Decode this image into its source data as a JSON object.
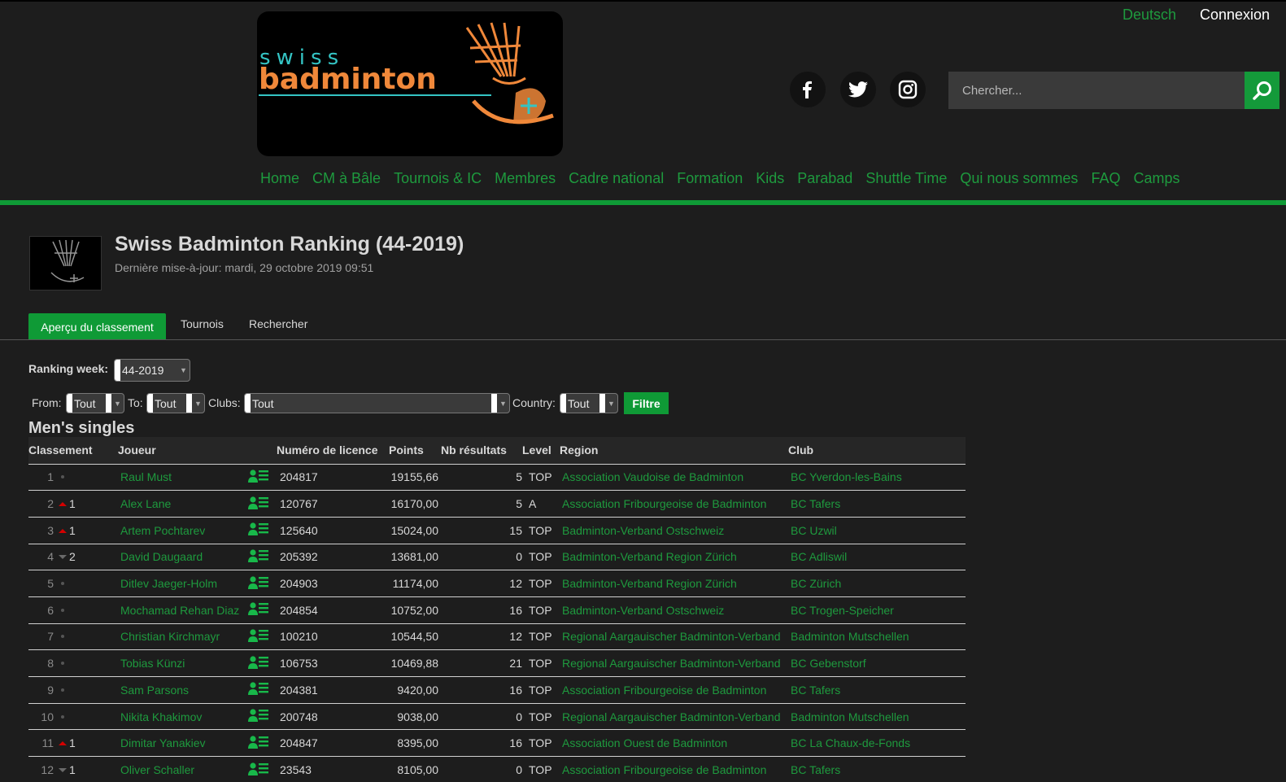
{
  "header": {
    "lang_link": "Deutsch",
    "login_link": "Connexion",
    "logo_text": "swiss badminton",
    "search_placeholder": "Chercher...",
    "social": [
      "facebook-icon",
      "twitter-icon",
      "instagram-icon"
    ]
  },
  "nav": [
    "Home",
    "CM à Bâle",
    "Tournois & IC",
    "Membres",
    "Cadre national",
    "Formation",
    "Kids",
    "Parabad",
    "Shuttle Time",
    "Qui nous sommes",
    "FAQ",
    "Camps"
  ],
  "page": {
    "title": "Swiss Badminton Ranking (44-2019)",
    "subtitle": "Dernière mise-à-jour: mardi, 29 octobre 2019 09:51"
  },
  "tabs": [
    "Aperçu du classement",
    "Tournois",
    "Rechercher"
  ],
  "filters": {
    "ranking_week_label": "Ranking week:",
    "ranking_week_value": "44-2019",
    "from_label": "From:",
    "from_value": "Tout",
    "to_label": "To:",
    "to_value": "Tout",
    "clubs_label": "Clubs:",
    "clubs_value": "Tout",
    "country_label": "Country:",
    "country_value": "Tout",
    "filter_button": "Filtre"
  },
  "table": {
    "section_title": "Men's singles",
    "headers": [
      "Classement",
      "Joueur",
      "Numéro de licence",
      "Points",
      "Nb résultats",
      "Level",
      "Region",
      "Club"
    ],
    "rows": [
      {
        "rank": "1",
        "move": "",
        "dir": "none",
        "player": "Raul Must",
        "license": "204817",
        "points": "19155,66",
        "results": "5",
        "level": "TOP",
        "region": "Association Vaudoise de Badminton",
        "club": "BC Yverdon-les-Bains"
      },
      {
        "rank": "2",
        "move": "1",
        "dir": "up",
        "player": "Alex Lane",
        "license": "120767",
        "points": "16170,00",
        "results": "5",
        "level": "A",
        "region": "Association Fribourgeoise de Badminton",
        "club": "BC Tafers"
      },
      {
        "rank": "3",
        "move": "1",
        "dir": "up",
        "player": "Artem Pochtarev",
        "license": "125640",
        "points": "15024,00",
        "results": "15",
        "level": "TOP",
        "region": "Badminton-Verband Ostschweiz",
        "club": "BC Uzwil"
      },
      {
        "rank": "4",
        "move": "2",
        "dir": "down",
        "player": "David Daugaard",
        "license": "205392",
        "points": "13681,00",
        "results": "0",
        "level": "TOP",
        "region": "Badminton-Verband Region Zürich",
        "club": "BC Adliswil"
      },
      {
        "rank": "5",
        "move": "",
        "dir": "none",
        "player": "Ditlev Jaeger-Holm",
        "license": "204903",
        "points": "11174,00",
        "results": "12",
        "level": "TOP",
        "region": "Badminton-Verband Region Zürich",
        "club": "BC Zürich"
      },
      {
        "rank": "6",
        "move": "",
        "dir": "none",
        "player": "Mochamad Rehan Diaz",
        "license": "204854",
        "points": "10752,00",
        "results": "16",
        "level": "TOP",
        "region": "Badminton-Verband Ostschweiz",
        "club": "BC Trogen-Speicher"
      },
      {
        "rank": "7",
        "move": "",
        "dir": "none",
        "player": "Christian Kirchmayr",
        "license": "100210",
        "points": "10544,50",
        "results": "12",
        "level": "TOP",
        "region": "Regional Aargauischer Badminton-Verband",
        "club": "Badminton Mutschellen"
      },
      {
        "rank": "8",
        "move": "",
        "dir": "none",
        "player": "Tobias Künzi",
        "license": "106753",
        "points": "10469,88",
        "results": "21",
        "level": "TOP",
        "region": "Regional Aargauischer Badminton-Verband",
        "club": "BC Gebenstorf"
      },
      {
        "rank": "9",
        "move": "",
        "dir": "none",
        "player": "Sam Parsons",
        "license": "204381",
        "points": "9420,00",
        "results": "16",
        "level": "TOP",
        "region": "Association Fribourgeoise de Badminton",
        "club": "BC Tafers"
      },
      {
        "rank": "10",
        "move": "",
        "dir": "none",
        "player": "Nikita Khakimov",
        "license": "200748",
        "points": "9038,00",
        "results": "0",
        "level": "TOP",
        "region": "Regional Aargauischer Badminton-Verband",
        "club": "Badminton Mutschellen"
      },
      {
        "rank": "11",
        "move": "1",
        "dir": "up",
        "player": "Dimitar Yanakiev",
        "license": "204847",
        "points": "8395,00",
        "results": "16",
        "level": "TOP",
        "region": "Association Ouest de Badminton",
        "club": "BC La Chaux-de-Fonds"
      },
      {
        "rank": "12",
        "move": "1",
        "dir": "down",
        "player": "Oliver Schaller",
        "license": "23543",
        "points": "8105,00",
        "results": "0",
        "level": "TOP",
        "region": "Association Fribourgeoise de Badminton",
        "club": "BC Tafers"
      }
    ]
  }
}
